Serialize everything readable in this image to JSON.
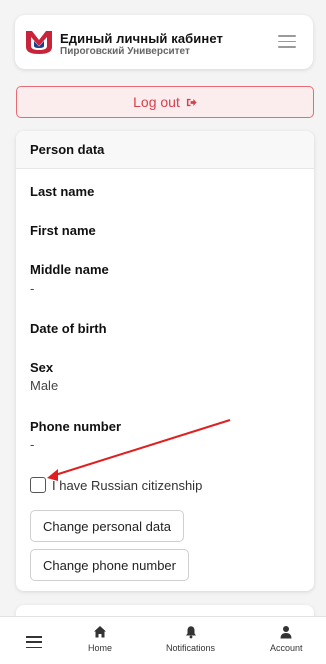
{
  "header": {
    "title": "Единый личный кабинет",
    "subtitle": "Пироговский Университет",
    "logo_icon": "university-logo-icon",
    "menu_icon": "hamburger-icon"
  },
  "logout": {
    "label": "Log out",
    "icon": "logout-icon"
  },
  "person": {
    "heading": "Person data",
    "fields": [
      {
        "label": "Last name",
        "value": ""
      },
      {
        "label": "First name",
        "value": ""
      },
      {
        "label": "Middle name",
        "value": "-"
      },
      {
        "label": "Date of birth",
        "value": ""
      },
      {
        "label": "Sex",
        "value": "Male"
      },
      {
        "label": "Phone number",
        "value": "-"
      }
    ],
    "citizenship_checkbox": {
      "label": "I have Russian citizenship",
      "checked": false
    },
    "buttons": {
      "change_personal": "Change personal data",
      "change_phone": "Change phone number"
    }
  },
  "bottom_nav": {
    "menu_icon": "hamburger-icon",
    "items": [
      {
        "label": "Home",
        "icon": "home-icon"
      },
      {
        "label": "Notifications",
        "icon": "bell-icon"
      },
      {
        "label": "Account",
        "icon": "user-icon"
      }
    ]
  },
  "colors": {
    "accent_red": "#d6404c",
    "annotation_arrow": "#e02020"
  }
}
